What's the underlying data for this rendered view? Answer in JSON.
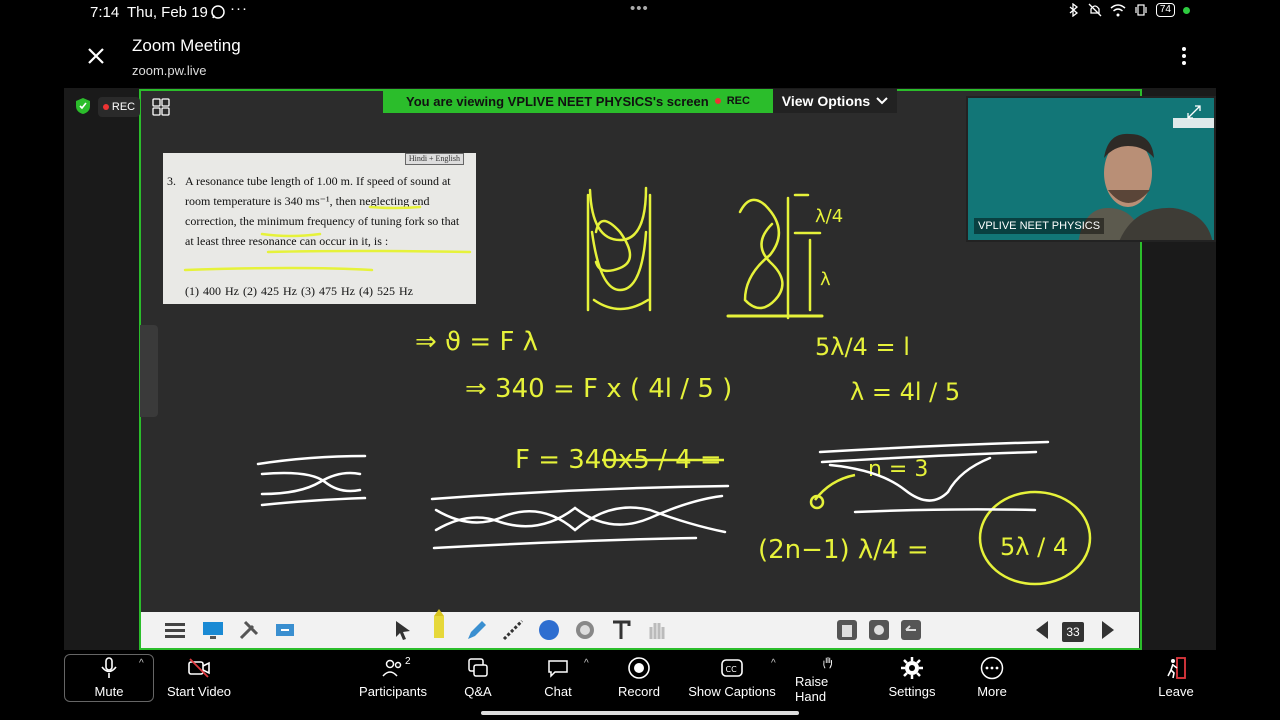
{
  "status": {
    "time": "7:14",
    "date": "Thu, Feb 19",
    "more": "···",
    "center_dots": "•••",
    "battery": "74"
  },
  "header": {
    "title": "Zoom Meeting",
    "subtitle": "zoom.pw.live"
  },
  "meeting": {
    "rec_label": "REC",
    "viewing_text": "You are viewing  VPLIVE NEET PHYSICS's screen",
    "viewing_rec": "REC",
    "view_options": "View Options",
    "video_label": "VPLIVE NEET PHYSICS",
    "page_number": "33"
  },
  "question": {
    "tag": "Hindi + English",
    "number": "3.",
    "text": "A resonance tube length of 1.00 m. If speed of sound at room temperature is 340 ms⁻¹, then neglecting end correction, the minimum frequency of tuning fork so that at least three resonance can occur in it, is :",
    "options": "(1)  400 Hz (2)   425 Hz (3)  475 Hz (4)  525 Hz"
  },
  "board": {
    "eq1": "⇒   ϑ = F λ",
    "eq2": "⇒ 340 = F x ( 4l / 5 )",
    "eq3": "F  =  340x5 / 4  =",
    "eq4": "5λ/4 = l",
    "eq5": "λ = 4l / 5",
    "eq6": "n = 3",
    "eq7": "(2n−1) λ/4  =",
    "eq8": "5λ / 4",
    "lambda4": "λ/4",
    "lambda": "λ"
  },
  "bottom": {
    "mute": "Mute",
    "start_video": "Start Video",
    "participants": "Participants",
    "participants_count": "2",
    "qa": "Q&A",
    "chat": "Chat",
    "record": "Record",
    "captions": "Show Captions",
    "raise_hand": "Raise Hand",
    "settings": "Settings",
    "more": "More",
    "leave": "Leave"
  },
  "colors": {
    "accent_green": "#2bbd2b",
    "ink_yellow": "#e6f23a",
    "ink_white": "#ffffff",
    "rec_red": "#e33333",
    "leave_red": "#e0383e"
  }
}
